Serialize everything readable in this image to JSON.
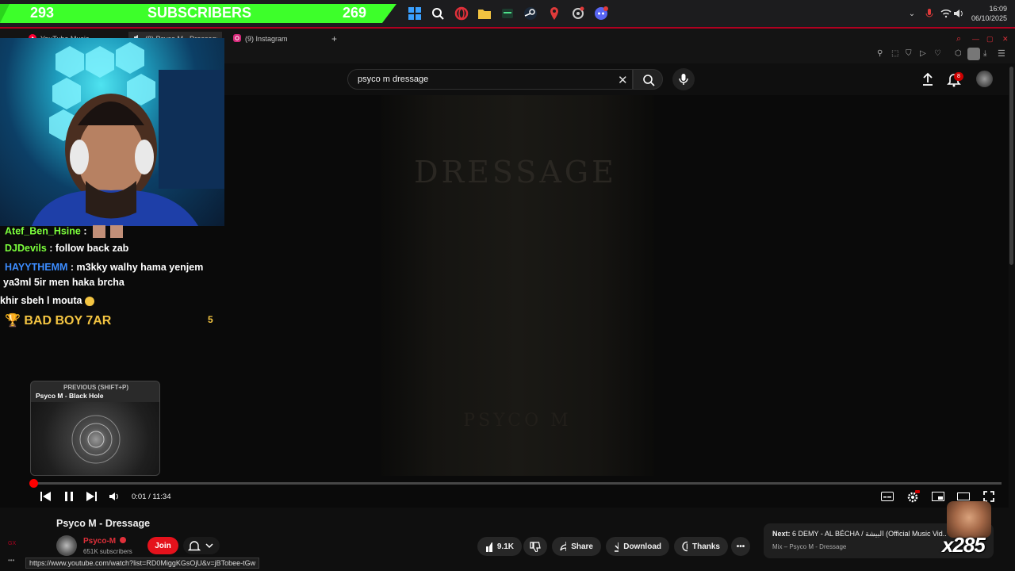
{
  "overlay": {
    "subscriber_goal": {
      "current": "293",
      "label": "SUBSCRIBERS",
      "remaining": "269"
    },
    "chat": [
      {
        "user": "Atef_Ben_Hsine",
        "user_color": "#7cff3c",
        "text": ":",
        "has_emotes": true
      },
      {
        "user": "DJDevils",
        "user_color": "#7cff3c",
        "text": ": follow back zab"
      },
      {
        "user": "HAYYTHEMM",
        "user_color": "#3c8cff",
        "text": ": m3kky walhy hama yenjem"
      },
      {
        "user": "",
        "text": "ya3ml 5ir men haka brcha"
      },
      {
        "user": "",
        "text": "khir sbeh l mouta"
      }
    ],
    "leaderboard": {
      "name": "BAD BOY 7AR",
      "count": "5"
    },
    "gift_badge": "x285"
  },
  "system": {
    "time": "16:09",
    "date": "06/10/2025"
  },
  "browser": {
    "tabs": [
      {
        "label": "YouTube Music",
        "active": false
      },
      {
        "label": "(8) Psyco M - Dressage",
        "active": true
      },
      {
        "label": "(9) Instagram",
        "active": false
      }
    ],
    "status_url": "https://www.youtube.com/watch?list=RD0MiggKGsOjU&v=jBTobee-tGw"
  },
  "youtube": {
    "search": {
      "query": "psyco m dressage"
    },
    "notifications_count": "8",
    "poster": {
      "title": "DRESSAGE",
      "artist": "PSYCO M"
    },
    "player": {
      "time": "0:01 / 11:34",
      "progress_fraction": 0.0014,
      "preview": {
        "header": "PREVIOUS (SHIFT+P)",
        "title": "Psyco M - Black Hole"
      }
    },
    "video": {
      "title": "Psyco M - Dressage",
      "channel": "Psyco-M",
      "subscribers": "651K subscribers",
      "join_label": "Join",
      "likes": "9.1K",
      "share_label": "Share",
      "download_label": "Download",
      "thanks_label": "Thanks"
    },
    "next": {
      "prefix": "Next:",
      "title": "6 DEMY - AL BÉCHA / البيشة (Official Music Vid...",
      "subtitle": "Mix – Psyco M - Dressage"
    }
  },
  "colors": {
    "accent": "#ff0000",
    "banner_green": "#3dff2a"
  }
}
